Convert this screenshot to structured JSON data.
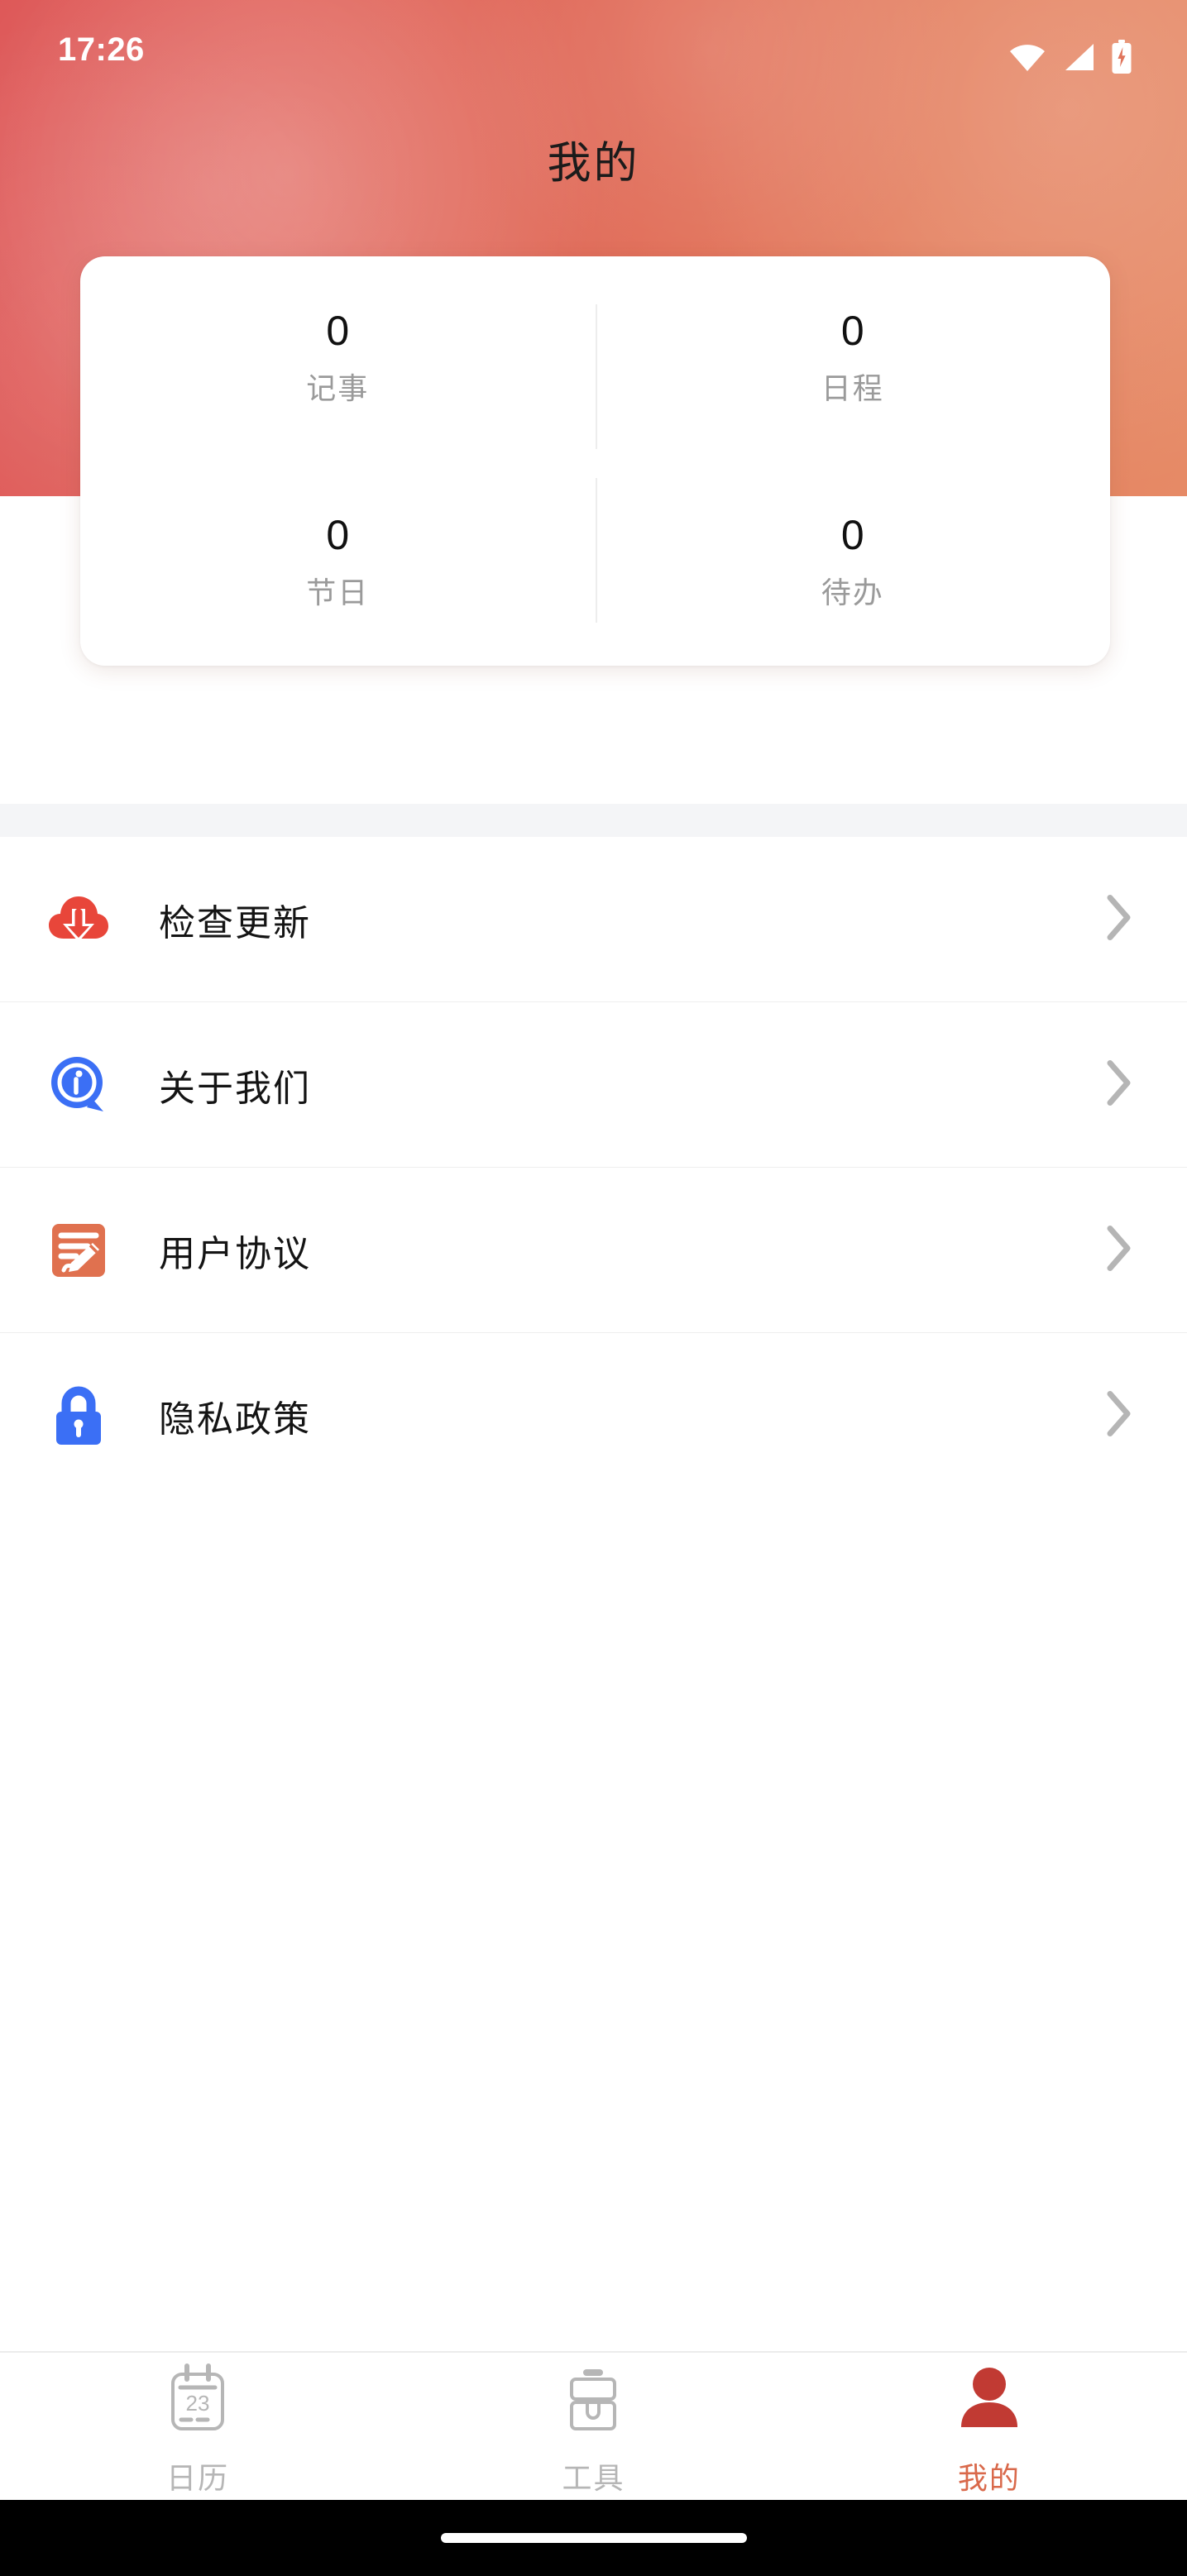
{
  "theme": {
    "header_gradient_from": "#dc4f4f",
    "header_gradient_to": "#e68a66",
    "accent": "#d9694b",
    "active_tab_color": "#d9694b",
    "card_background": "#ffffff",
    "divider": "#eeeeee",
    "section_band": "#f4f5f7",
    "label_gray": "#9a9a9a",
    "tab_inactive": "#b6b6b6"
  },
  "status_bar": {
    "time": "17:26",
    "icons": [
      {
        "name": "wifi-icon",
        "label": "wifi-full"
      },
      {
        "name": "cellular-signal-icon",
        "label": "signal-full"
      },
      {
        "name": "battery-charging-icon",
        "label": "battery-charging"
      }
    ]
  },
  "header": {
    "title": "我的"
  },
  "stats_card": {
    "items": [
      {
        "value": "0",
        "label": "记事",
        "name": "stat-notes"
      },
      {
        "value": "0",
        "label": "日程",
        "name": "stat-schedule"
      },
      {
        "value": "0",
        "label": "节日",
        "name": "stat-holiday"
      },
      {
        "value": "0",
        "label": "待办",
        "name": "stat-todo"
      }
    ]
  },
  "menu": {
    "items": [
      {
        "label": "检查更新",
        "icon": "cloud-download-icon",
        "icon_color": "#e8463a",
        "chevron": "chevron-right-icon"
      },
      {
        "label": "关于我们",
        "icon": "info-bubble-icon",
        "icon_color": "#3b6ff5",
        "chevron": "chevron-right-icon"
      },
      {
        "label": "用户协议",
        "icon": "document-edit-icon",
        "icon_color": "#e0714f",
        "chevron": "chevron-right-icon"
      },
      {
        "label": "隐私政策",
        "icon": "lock-icon",
        "icon_color": "#3b6ff5",
        "chevron": "chevron-right-icon"
      }
    ]
  },
  "tabbar": {
    "tabs": [
      {
        "label": "日历",
        "icon": "calendar-icon",
        "icon_day": "23",
        "active": false
      },
      {
        "label": "工具",
        "icon": "toolbox-icon",
        "active": false
      },
      {
        "label": "我的",
        "icon": "person-icon",
        "active": true
      }
    ]
  },
  "system_nav": {
    "gesture_pill": "home-gesture-pill"
  }
}
